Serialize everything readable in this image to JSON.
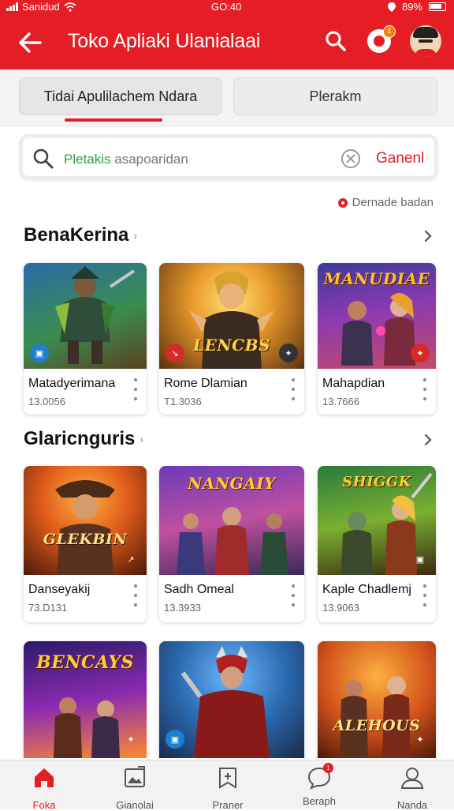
{
  "status_bar": {
    "carrier": "Sanidud",
    "time": "GO:40",
    "battery": "89%"
  },
  "app_bar": {
    "title": "Toko Apliaki Ulanialaai",
    "notification_count": "1"
  },
  "tabs": [
    {
      "label": "Tidai  Apulilachem  Ndara",
      "active": true
    },
    {
      "label": "Plerakm",
      "active": false
    }
  ],
  "search": {
    "query_highlight": "Pletakis",
    "query_rest": " asapoaridan",
    "cancel_label": "Ganenl"
  },
  "sort_label": "Dernade badan",
  "sections": [
    {
      "title": "BenaKerina",
      "apps": [
        {
          "name": "Matadyerimana",
          "count": "13.0056",
          "art_text": ""
        },
        {
          "name": "Rome Dlamian",
          "count": "T1.3036",
          "art_text": "LENCBS"
        },
        {
          "name": "Mahapdian",
          "count": "13.7666",
          "art_text": "MANUDIAE"
        }
      ]
    },
    {
      "title": "Glaricnguris",
      "apps": [
        {
          "name": "Danseyakij",
          "count": "73.D131",
          "art_text": "GLEKBIN"
        },
        {
          "name": "Sadh Omeal",
          "count": "13.3933",
          "art_text": "NANGAIY"
        },
        {
          "name": "Kaple Chadlemj",
          "count": "13.9063",
          "art_text": "SHIGGK"
        }
      ]
    },
    {
      "title": "",
      "apps": [
        {
          "art_text": "BENCAYS"
        },
        {
          "art_text": ""
        },
        {
          "art_text": "ALEHOUS"
        }
      ]
    }
  ],
  "bottom_nav": [
    {
      "label": "Foka",
      "icon": "home-icon",
      "active": true
    },
    {
      "label": "Gianolai",
      "icon": "gallery-icon",
      "active": false
    },
    {
      "label": "Praner",
      "icon": "bookmark-icon",
      "active": false
    },
    {
      "label": "Beraph",
      "icon": "chat-icon",
      "active": false,
      "badge": "1"
    },
    {
      "label": "Nanda",
      "icon": "person-icon",
      "active": false
    }
  ],
  "colors": {
    "accent": "#e41e24",
    "search_highlight": "#2c9f3a"
  }
}
